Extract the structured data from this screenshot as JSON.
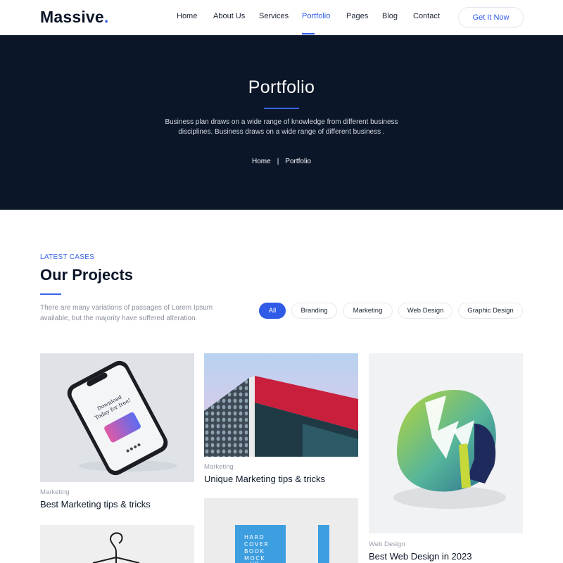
{
  "header": {
    "logo_text": "Massive",
    "logo_dot": ".",
    "nav": [
      "Home",
      "About Us",
      "Services",
      "Portfolio",
      "Pages",
      "Blog",
      "Contact"
    ],
    "active_nav": "Portfolio",
    "cta_label": "Get It Now"
  },
  "hero": {
    "title": "Portfolio",
    "description": "Business plan draws on a wide range of knowledge from different business disciplines. Business draws on a wide range of different business .",
    "breadcrumb": [
      "Home",
      "Portfolio"
    ],
    "breadcrumb_separator": "|"
  },
  "projects": {
    "eyebrow": "LATEST CASES",
    "title": "Our Projects",
    "description": "There are many variations of passages of Lorem Ipsum available, but the majority have suffered alteration.",
    "filters": [
      "All",
      "Branding",
      "Marketing",
      "Web Design",
      "Graphic Design"
    ],
    "active_filter": "All",
    "cards": [
      {
        "category": "Marketing",
        "title": "Best Marketing tips & tricks",
        "image": "phone-mockup-image"
      },
      {
        "category": "Marketing",
        "title": "Unique Marketing tips & tricks",
        "image": "building-architecture-image"
      },
      {
        "category": "Web Design",
        "title": "Best Web Design in 2023",
        "image": "helmet-image"
      }
    ],
    "phone_screen_text": [
      "Download",
      "Today for free!"
    ],
    "book_cover_text": [
      "HARD",
      "COVER",
      "BOOK",
      "MOCK",
      "UP"
    ]
  },
  "colors": {
    "accent": "#2f5be7",
    "hero_bg": "#0b1628",
    "text_dark": "#0b1628",
    "text_muted": "#8a8f9c"
  }
}
